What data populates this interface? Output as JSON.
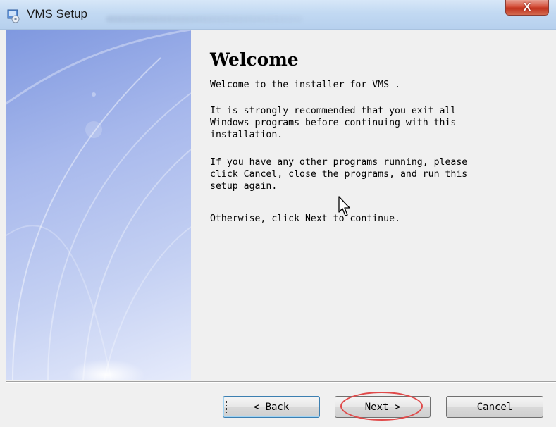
{
  "window": {
    "title": "VMS Setup",
    "close_glyph": "X"
  },
  "content": {
    "heading": "Welcome",
    "paragraphs": [
      "Welcome to the installer for VMS .",
      "It is strongly recommended that you exit all\nWindows programs before continuing with this\ninstallation.",
      "If you have any other programs running, please\nclick Cancel, close the programs, and run this\nsetup again.",
      "Otherwise, click Next to continue."
    ]
  },
  "buttons": {
    "back": {
      "prefix": "< ",
      "accel": "B",
      "rest": "ack"
    },
    "next": {
      "accel": "N",
      "rest": "ext",
      "suffix": " >"
    },
    "cancel": {
      "accel": "C",
      "rest": "ancel"
    }
  },
  "icons": {
    "app": "installer-icon",
    "close": "close-icon",
    "cursor": "mouse-pointer-icon"
  },
  "colors": {
    "titlebar": "#c2d9f2",
    "close_button": "#c1321e",
    "annotation": "#e04a4a",
    "panel_blue": "#7f98df"
  }
}
